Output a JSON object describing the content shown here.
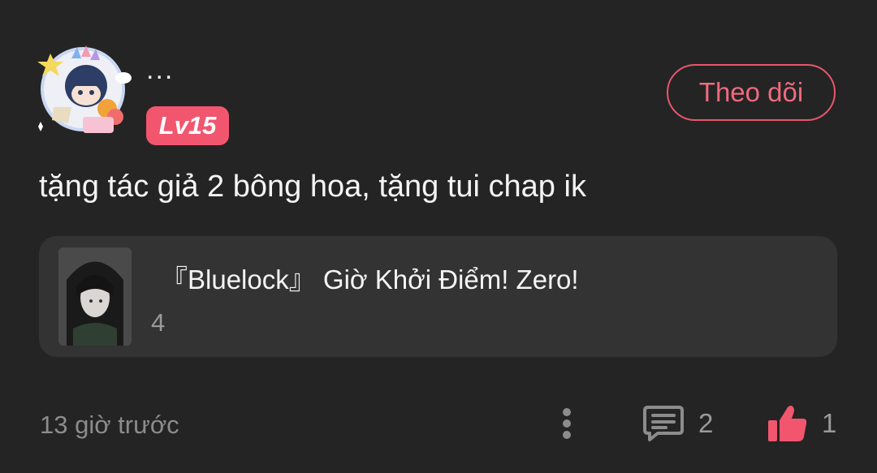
{
  "comment": {
    "username": "...",
    "level": "Lv15",
    "follow_label": "Theo dõi",
    "text": "tặng tác giả 2 bông hoa, tặng tui chap ik",
    "timestamp": "13 giờ trước",
    "reply_count": "2",
    "like_count": "1"
  },
  "story": {
    "title": "『Bluelock』 Giờ Khởi Điểm! Zero!",
    "chapter": "4"
  },
  "icons": {
    "avatar": "user-avatar-with-frame",
    "more": "vertical-ellipsis-icon",
    "reply": "comment-bubble-icon",
    "like": "thumbs-up-icon"
  },
  "colors": {
    "background": "#242424",
    "card": "#333333",
    "accent": "#f2566f",
    "muted_text": "#8c8c8c"
  }
}
